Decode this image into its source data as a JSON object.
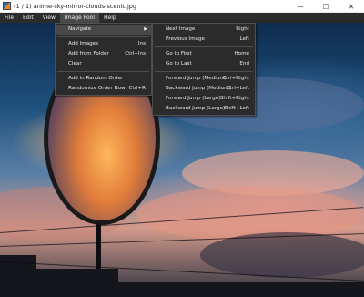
{
  "window": {
    "title": "(1 / 1) anime-sky-mirror-clouds-scenic.jpg",
    "controls": {
      "minimize": "—",
      "maximize": "☐",
      "close": "✕"
    }
  },
  "menubar": {
    "items": [
      {
        "label": "File"
      },
      {
        "label": "Edit"
      },
      {
        "label": "View"
      },
      {
        "label": "Image Pool"
      },
      {
        "label": "Help"
      }
    ]
  },
  "image_pool_menu": {
    "items": [
      {
        "label": "Navigate",
        "shortcut": "",
        "submenu": true
      },
      {
        "label": "Add Images",
        "shortcut": "Ins"
      },
      {
        "label": "Add from Folder",
        "shortcut": "Ctrl+Ins"
      },
      {
        "label": "Clear",
        "shortcut": ""
      },
      {
        "label": "Add in Random Order",
        "shortcut": ""
      },
      {
        "label": "Randomize Order Now",
        "shortcut": "Ctrl+R"
      }
    ]
  },
  "navigate_submenu": {
    "items": [
      {
        "label": "Next Image",
        "shortcut": "Right"
      },
      {
        "label": "Previous Image",
        "shortcut": "Left"
      },
      {
        "label": "Go to First",
        "shortcut": "Home"
      },
      {
        "label": "Go to Last",
        "shortcut": "End"
      },
      {
        "label": "Forward Jump (Medium)",
        "shortcut": "Ctrl+Right"
      },
      {
        "label": "Backward Jump (Medium)",
        "shortcut": "Ctrl+Left"
      },
      {
        "label": "Forward Jump (Large)",
        "shortcut": "Shift+Right"
      },
      {
        "label": "Backward Jump (Large)",
        "shortcut": "Shift+Left"
      }
    ]
  },
  "colors": {
    "menu_bg": "#2b2b2b",
    "menu_highlight": "#474747",
    "menu_text": "#e8e8e8"
  }
}
